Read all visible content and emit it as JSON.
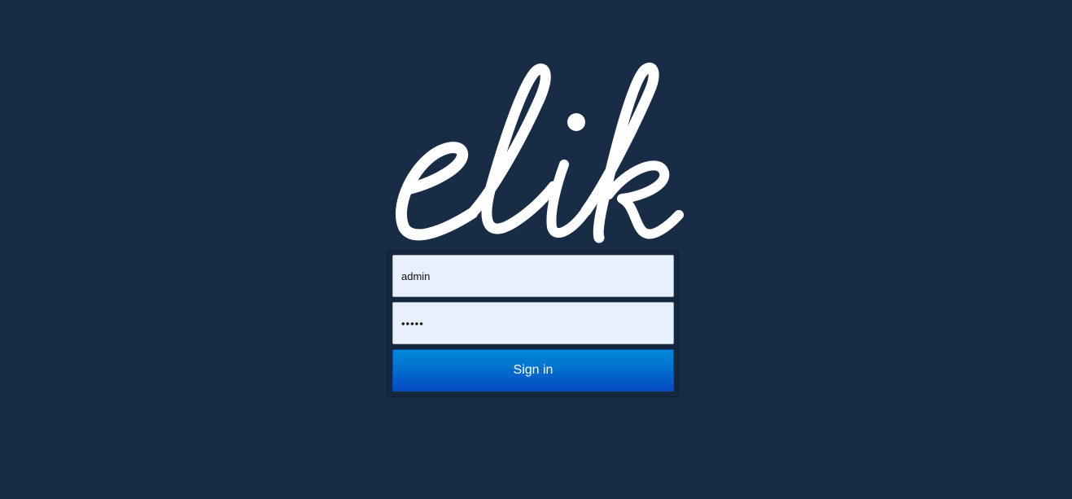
{
  "logo": {
    "text": "elik",
    "color": "#ffffff"
  },
  "login": {
    "username_value": "admin",
    "password_value": "•••••",
    "signin_label": "Sign in"
  },
  "colors": {
    "background": "#182c45",
    "panel": "#15273c",
    "field_bg": "#e8f0fd",
    "button_top": "#0288d8",
    "button_bottom": "#0549c2"
  }
}
